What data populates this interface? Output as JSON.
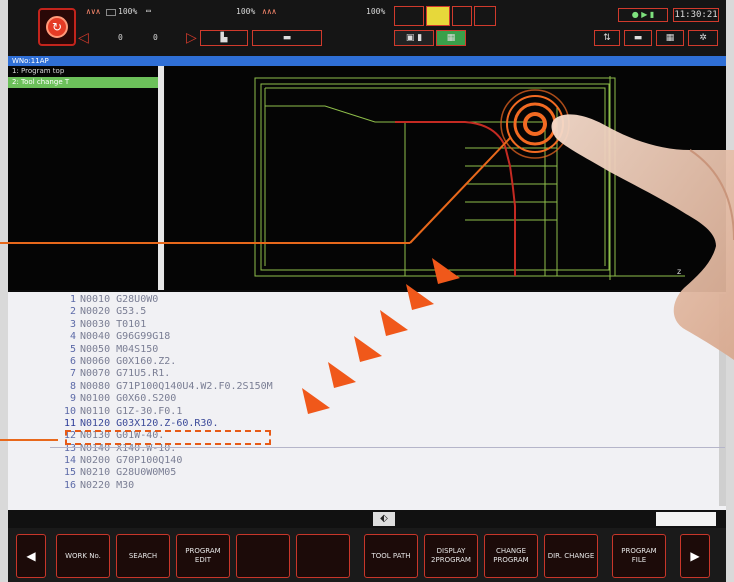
{
  "topbar": {
    "spindle_label": "100%",
    "feed_label": "100%",
    "rapid_label": "100%",
    "digits": [
      "0",
      "0"
    ],
    "clock": "11:30:21",
    "icons": [
      "home-icon",
      "waveform-icon",
      "battery-icon",
      "wrench-icon",
      "chuck-icon",
      "arrow-left-icon",
      "arrow-right-icon",
      "grid-icon",
      "gear-icon"
    ]
  },
  "titlebar": {
    "title": "WNo:11AP"
  },
  "program_list": {
    "items": [
      {
        "label": "1: Program top",
        "active": false
      },
      {
        "label": "2: Tool change T",
        "active": true
      }
    ]
  },
  "code": {
    "lines": [
      {
        "no": "1",
        "text": "N0010 G28U0W0"
      },
      {
        "no": "2",
        "text": "N0020 G53.5"
      },
      {
        "no": "3",
        "text": "N0030 T0101"
      },
      {
        "no": "4",
        "text": "N0040 G96G99G18"
      },
      {
        "no": "5",
        "text": "N0050 M04S150"
      },
      {
        "no": "6",
        "text": "N0060 G0X160.Z2."
      },
      {
        "no": "7",
        "text": "N0070 G71U5.R1."
      },
      {
        "no": "8",
        "text": "N0080 G71P100Q140U4.W2.F0.2S150M"
      },
      {
        "no": "9",
        "text": "N0100 G0X60.S200"
      },
      {
        "no": "10",
        "text": "N0110 G1Z-30.F0.1"
      },
      {
        "no": "11",
        "text": "N0120 G03X120.Z-60.R30."
      },
      {
        "no": "12",
        "text": "N0130 G01W-40."
      },
      {
        "no": "13",
        "text": "N0140 X140.W-10."
      },
      {
        "no": "14",
        "text": "N0200 G70P100Q140"
      },
      {
        "no": "15",
        "text": "N0210 G28U0W0M05"
      },
      {
        "no": "16",
        "text": "N0220 M30"
      }
    ],
    "selected_line": "11"
  },
  "softkeys": {
    "prev": "◀",
    "next": "▶",
    "keys": [
      "WORK No.",
      "SEARCH",
      "PROGRAM EDIT",
      "",
      "",
      "TOOL PATH",
      "DISPLAY 2PROGRAM",
      "CHANGE PROGRAM",
      "DIR. CHANGE",
      "PROGRAM FILE"
    ]
  },
  "subbar": {
    "toggle": "⬖"
  },
  "colors": {
    "accent": "#d03a2c",
    "title_blue": "#2f6fd6",
    "active_green": "#6cc05a",
    "callout_orange": "#e8681b"
  }
}
